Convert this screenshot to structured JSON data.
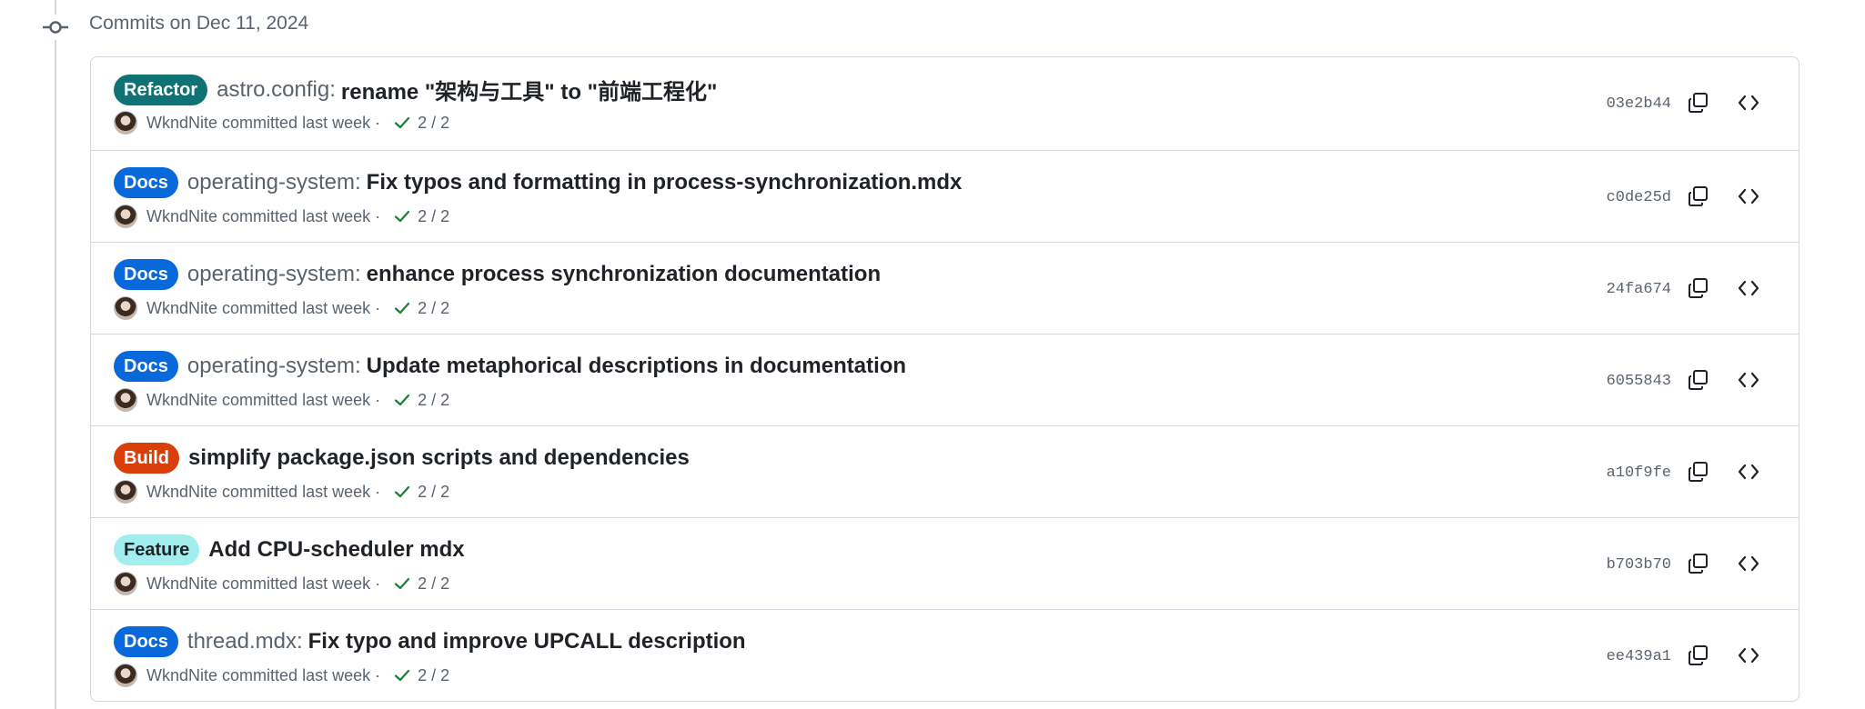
{
  "group": {
    "title": "Commits on Dec 11, 2024"
  },
  "badge_colors": {
    "Refactor": {
      "bg": "#0f7275",
      "fg": "#ffffff"
    },
    "Docs": {
      "bg": "#0969da",
      "fg": "#ffffff"
    },
    "Build": {
      "bg": "#d93f0b",
      "fg": "#ffffff"
    },
    "Feature": {
      "bg": "#a2eeef",
      "fg": "#1f2328"
    }
  },
  "commits": [
    {
      "badge": "Refactor",
      "scope": "astro.config:",
      "message": "rename \"架构与工具\" to \"前端工程化\"",
      "author": "WkndNite",
      "action": "committed last week · ",
      "checks": "2 / 2",
      "sha": "03e2b44"
    },
    {
      "badge": "Docs",
      "scope": "operating-system:",
      "message": "Fix typos and formatting in process-synchronization.mdx",
      "author": "WkndNite",
      "action": "committed last week · ",
      "checks": "2 / 2",
      "sha": "c0de25d"
    },
    {
      "badge": "Docs",
      "scope": "operating-system:",
      "message": "enhance process synchronization documentation",
      "author": "WkndNite",
      "action": "committed last week · ",
      "checks": "2 / 2",
      "sha": "24fa674"
    },
    {
      "badge": "Docs",
      "scope": "operating-system:",
      "message": "Update metaphorical descriptions in documentation",
      "author": "WkndNite",
      "action": "committed last week · ",
      "checks": "2 / 2",
      "sha": "6055843"
    },
    {
      "badge": "Build",
      "scope": "",
      "message": "simplify package.json scripts and dependencies",
      "author": "WkndNite",
      "action": "committed last week · ",
      "checks": "2 / 2",
      "sha": "a10f9fe"
    },
    {
      "badge": "Feature",
      "scope": "",
      "message": "Add CPU-scheduler mdx",
      "author": "WkndNite",
      "action": "committed last week · ",
      "checks": "2 / 2",
      "sha": "b703b70"
    },
    {
      "badge": "Docs",
      "scope": "thread.mdx:",
      "message": "Fix typo and improve UPCALL description",
      "author": "WkndNite",
      "action": "committed last week · ",
      "checks": "2 / 2",
      "sha": "ee439a1"
    }
  ],
  "icons": {
    "timeline": "git-commit-icon",
    "check": "check-icon",
    "copy": "copy-icon",
    "browse": "code-icon"
  }
}
